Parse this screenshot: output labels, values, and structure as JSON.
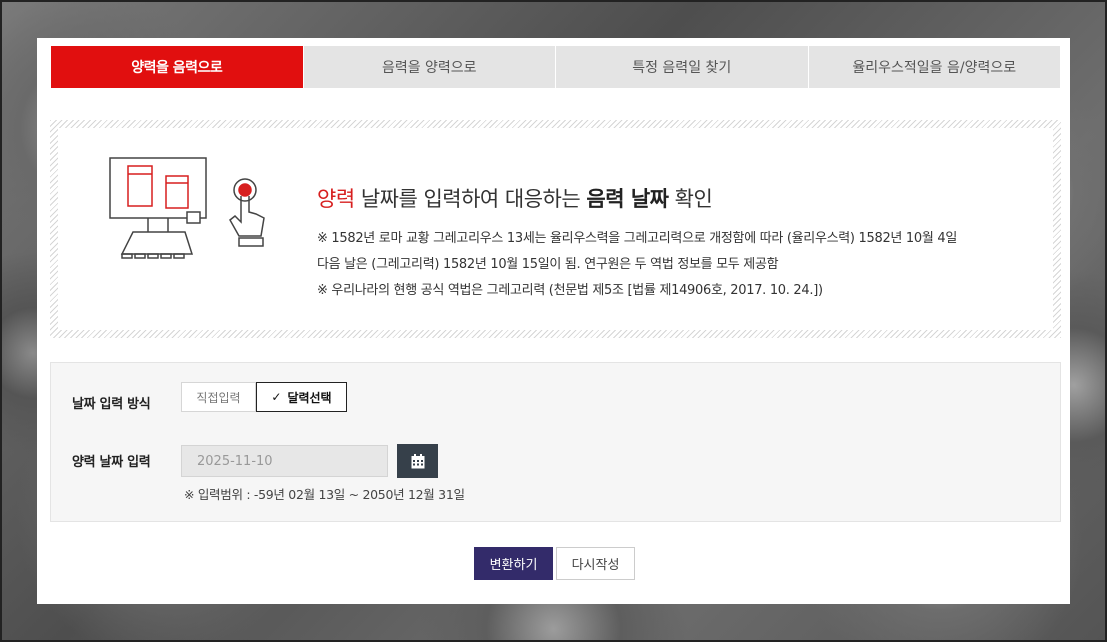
{
  "tabs": [
    {
      "label": "양력을 음력으로",
      "active": true
    },
    {
      "label": "음력을 양력으로",
      "active": false
    },
    {
      "label": "특정 음력일 찾기",
      "active": false
    },
    {
      "label": "율리우스적일을 음/양력으로",
      "active": false
    }
  ],
  "info": {
    "title_red": "양력",
    "title_mid": " 날짜를 입력하여 대응하는 ",
    "title_bold": "음력 날짜",
    "title_end": " 확인",
    "notes": [
      "※ 1582년 로마 교황 그레고리우스 13세는 율리우스력을 그레고리력으로 개정함에 따라 (율리우스력) 1582년 10월 4일",
      "다음 날은 (그레고리력) 1582년 10월 15일이 됨. 연구원은 두 역법 정보를 모두 제공함",
      "※ 우리나라의 현행 공식 역법은 그레고리력 (천문법 제5조 [법률 제14906호, 2017. 10. 24.])"
    ]
  },
  "form": {
    "method_label": "날짜 입력 방식",
    "method_options": [
      "직접입력",
      "달력선택"
    ],
    "method_selected": "달력선택",
    "check_glyph": "✓",
    "date_label": "양력 날짜 입력",
    "date_value": "2025-11-10",
    "range_note": "※ 입력범위 : -59년 02월 13일 ~ 2050년 12월 31일"
  },
  "buttons": {
    "convert": "변환하기",
    "reset": "다시작성"
  },
  "colors": {
    "accent_red": "#e10f0f",
    "primary_button": "#332b6a",
    "calendar_button": "#36404a"
  }
}
